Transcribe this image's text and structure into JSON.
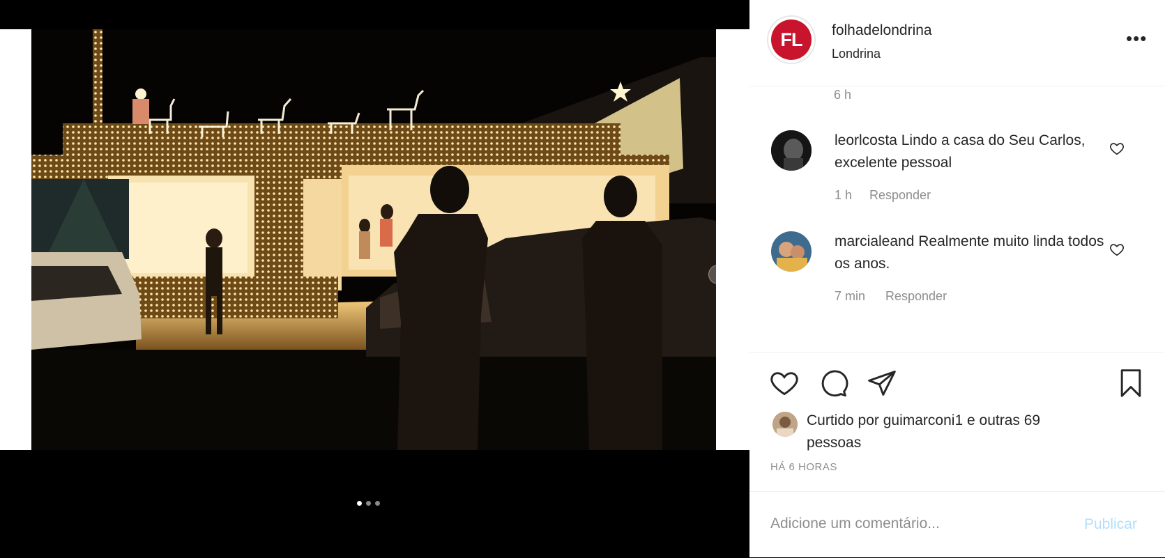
{
  "post": {
    "username": "folhadelondrina",
    "location": "Londrina",
    "avatar_initials": "FL",
    "more_icon": "more-horizontal-icon"
  },
  "comments": {
    "header_time": "6 h",
    "items": [
      {
        "user": "leorlcosta",
        "text": "Lindo a casa do Seu Carlos, excelente pessoal",
        "time": "1 h",
        "reply_label": "Responder"
      },
      {
        "user": "marcialeand",
        "text": "Realmente muito linda todos os anos.",
        "time": "7 min",
        "reply_label": "Responder"
      }
    ]
  },
  "actions": {
    "like_icon": "heart-icon",
    "comment_icon": "comment-icon",
    "share_icon": "send-icon",
    "save_icon": "bookmark-icon"
  },
  "likes": {
    "prefix": "Curtido por",
    "user": "guimarconi1",
    "suffix": "e",
    "others": "outras 69 pessoas"
  },
  "posted_ago": "HÁ 6 HORAS",
  "add_comment": {
    "placeholder": "Adicione um comentário...",
    "publish_label": "Publicar"
  },
  "carousel": {
    "slides": 3,
    "current": 1
  },
  "colors": {
    "brand": "#c8142c",
    "publish_disabled": "#b2dffc",
    "secondary_text": "#8e8e8e"
  }
}
